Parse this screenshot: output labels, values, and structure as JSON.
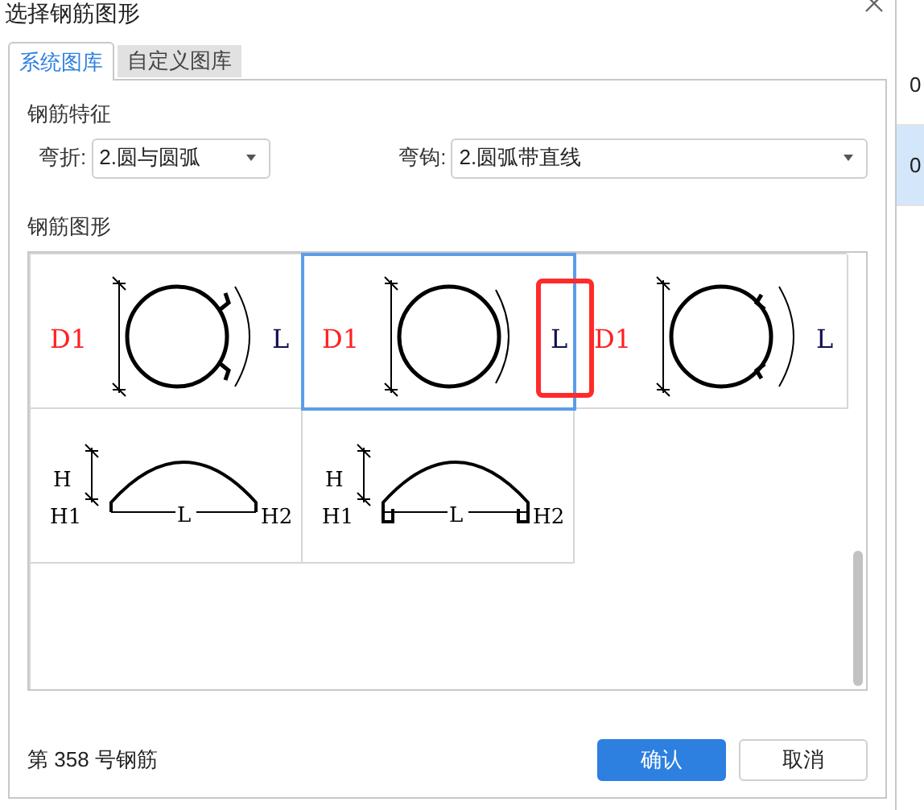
{
  "window": {
    "title": "选择钢筋图形"
  },
  "tabs": [
    {
      "label": "系统图库",
      "selected": true
    },
    {
      "label": "自定义图库",
      "selected": false
    }
  ],
  "feature_group": {
    "title": "钢筋特征",
    "fields": [
      {
        "label": "弯折:",
        "value": "2.圆与圆弧"
      },
      {
        "label": "弯钩:",
        "value": "2.圆弧带直线"
      }
    ]
  },
  "shapes_group": {
    "title": "钢筋图形",
    "shapes": [
      {
        "kind": "circle-hooks-out",
        "selected": false,
        "labels": [
          "D1",
          "L"
        ]
      },
      {
        "kind": "circle-plain",
        "selected": true,
        "labels": [
          "D1",
          "L"
        ]
      },
      {
        "kind": "circle-hooks-in",
        "selected": false,
        "labels": [
          "D1",
          "L"
        ]
      },
      {
        "kind": "arc-straight",
        "selected": false,
        "labels": [
          "H",
          "H1",
          "L",
          "H2"
        ]
      },
      {
        "kind": "arc-hooks",
        "selected": false,
        "labels": [
          "H",
          "H1",
          "L",
          "H2"
        ]
      }
    ]
  },
  "status": "第 358 号钢筋",
  "buttons": [
    {
      "label": "确认",
      "kind": "primary"
    },
    {
      "label": "取消",
      "kind": "secondary"
    }
  ],
  "side_list": [
    {
      "text": "0",
      "selected": false
    },
    {
      "text": "0",
      "selected": true
    }
  ]
}
